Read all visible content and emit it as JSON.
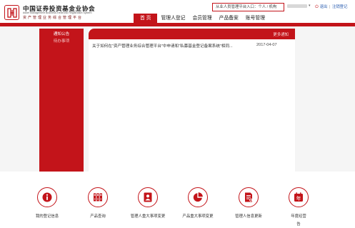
{
  "header": {
    "org_name_cn": "中国证券投资基金业协会",
    "org_name_en": "Asset Management Business Electronic Registration System",
    "org_sub_cn": "资产管理业务综合管理平台",
    "entry_label": "从业人员管理平台入口：",
    "entry_personal": "个人",
    "entry_sep": "/",
    "entry_org": "机构",
    "link_logout": "退出",
    "link_cancel": "注销登记",
    "link_divider": "|"
  },
  "nav": {
    "items": [
      {
        "label": "首 页",
        "active": true
      },
      {
        "label": "管理人登记",
        "active": false
      },
      {
        "label": "会员管理",
        "active": false
      },
      {
        "label": "产品备案",
        "active": false
      },
      {
        "label": "账号管理",
        "active": false
      }
    ]
  },
  "sidebar": {
    "items": [
      {
        "label": "通知公告",
        "active": true
      },
      {
        "label": "待办事项",
        "active": false
      }
    ]
  },
  "panel": {
    "more_label": "更多通知",
    "notices": [
      {
        "title": "关于如何在“资产管理业务综合管理平台”中申请和“私募基金登记备案系统”相同...",
        "date": "2017-04-07"
      }
    ]
  },
  "features": [
    {
      "label": "我的登记信息",
      "icon": "info-icon"
    },
    {
      "label": "产品查询",
      "icon": "binders-icon"
    },
    {
      "label": "管理人重大事项变更",
      "icon": "person-card-icon"
    },
    {
      "label": "产品重大事项变更",
      "icon": "pie-chart-icon"
    },
    {
      "label": "管理人信息更新",
      "icon": "document-icon"
    },
    {
      "label": "年度经营",
      "label2": "告",
      "icon": "calendar-year-icon",
      "icon_glyph": "年"
    }
  ],
  "colors": {
    "brand_red": "#c3141a",
    "link_blue": "#2a5db0",
    "content_bg": "#f5f5f5"
  }
}
